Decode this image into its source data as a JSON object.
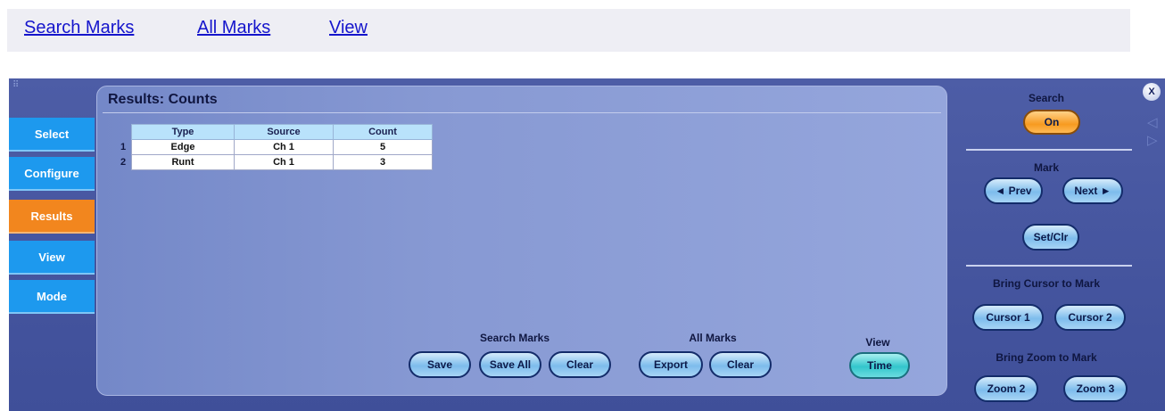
{
  "links": {
    "search_marks": "Search Marks",
    "all_marks": "All Marks",
    "view": "View"
  },
  "tabs": [
    {
      "label": "Select",
      "active": false
    },
    {
      "label": "Configure",
      "active": false
    },
    {
      "label": "Results",
      "active": true
    },
    {
      "label": "View",
      "active": false
    },
    {
      "label": "Mode",
      "active": false
    }
  ],
  "results": {
    "title": "Results: Counts",
    "columns": [
      "Type",
      "Source",
      "Count"
    ],
    "rows": [
      {
        "num": "1",
        "type": "Edge",
        "source": "Ch 1",
        "count": "5"
      },
      {
        "num": "2",
        "type": "Runt",
        "source": "Ch 1",
        "count": "3"
      }
    ]
  },
  "bottom": {
    "search_marks_label": "Search Marks",
    "save": "Save",
    "save_all": "Save All",
    "clear_search": "Clear",
    "all_marks_label": "All Marks",
    "export": "Export",
    "clear_all": "Clear",
    "view_label": "View",
    "time": "Time"
  },
  "side": {
    "close": "X",
    "search_label": "Search",
    "search_state": "On",
    "mark_label": "Mark",
    "prev": "◄ Prev",
    "next": "Next ►",
    "set_clr": "Set/Clr",
    "cursor_label": "Bring Cursor to Mark",
    "cursor1": "Cursor 1",
    "cursor2": "Cursor 2",
    "zoom_label": "Bring Zoom to Mark",
    "zoom2": "Zoom 2",
    "zoom3": "Zoom 3"
  },
  "colors": {
    "panel": "#4d5da6",
    "tab": "#1d99ee",
    "tab_active": "#f2861e",
    "search_on": "#f79a20",
    "time_button": "#33c6cc"
  }
}
